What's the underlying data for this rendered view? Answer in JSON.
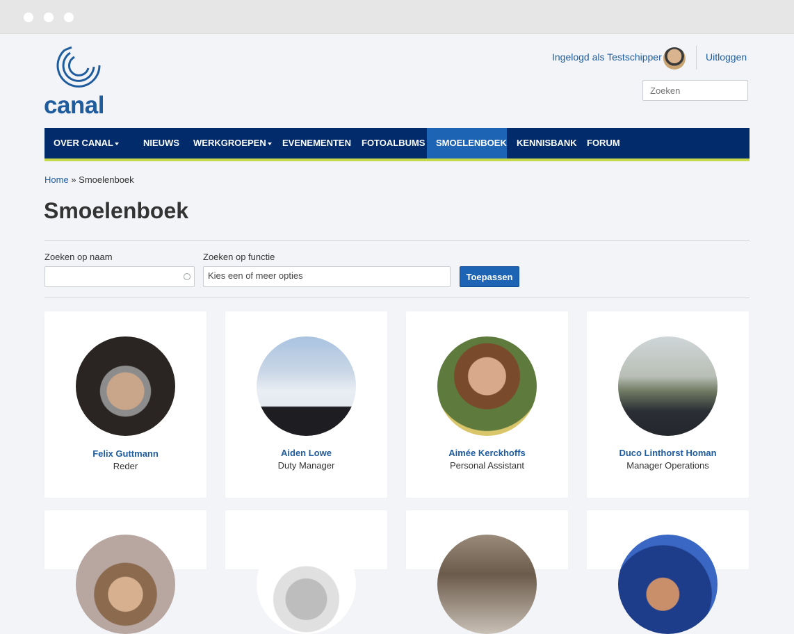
{
  "site": {
    "logo_text": "canal"
  },
  "user": {
    "logged_in_text": "Ingelogd als Testschipper",
    "logout_label": "Uitloggen"
  },
  "search": {
    "placeholder": "Zoeken"
  },
  "nav": {
    "items": [
      {
        "label": "OVER CANAL",
        "dropdown": true
      },
      {
        "label": "NIEUWS"
      },
      {
        "label": "WERKGROEPEN",
        "dropdown": true
      },
      {
        "label": "EVENEMENTEN"
      },
      {
        "label": "FOTOALBUMS"
      },
      {
        "label": "SMOELENBOEK",
        "active": true
      },
      {
        "label": "KENNISBANK"
      },
      {
        "label": "FORUM"
      }
    ]
  },
  "breadcrumb": {
    "home": "Home",
    "separator": " » ",
    "current": "Smoelenboek"
  },
  "page": {
    "title": "Smoelenboek"
  },
  "filters": {
    "name_label": "Zoeken op naam",
    "function_label": "Zoeken op functie",
    "function_placeholder": "Kies een of meer opties",
    "apply_label": "Toepassen"
  },
  "people": [
    {
      "name": "Felix Guttmann",
      "role": "Reder"
    },
    {
      "name": "Aiden Lowe",
      "role": "Duty Manager"
    },
    {
      "name": "Aimée Kerckhoffs",
      "role": "Personal Assistant"
    },
    {
      "name": "Duco Linthorst Homan",
      "role": "Manager Operations"
    }
  ],
  "colors": {
    "nav_bg": "#012b6b",
    "nav_active": "#1e64b4",
    "nav_underline": "#c6d94a",
    "link": "#1e5c9e"
  }
}
